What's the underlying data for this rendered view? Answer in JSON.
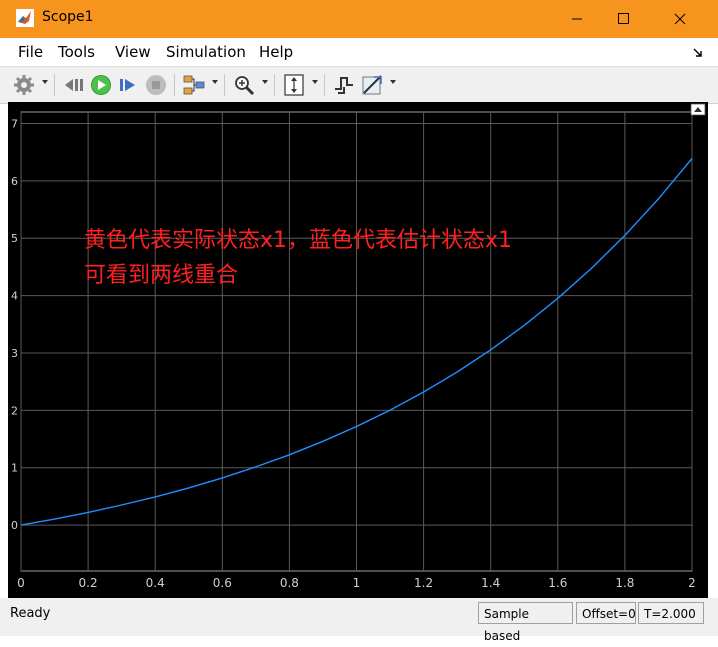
{
  "window": {
    "title": "Scope1"
  },
  "menu": {
    "items": [
      "File",
      "Tools",
      "View",
      "Simulation",
      "Help"
    ]
  },
  "toolbar": {
    "icons": [
      "gear-icon",
      "step-back-icon",
      "run-icon",
      "step-forward-icon",
      "stop-icon",
      "signal-selector-icon",
      "zoom-icon",
      "scale-axes-icon",
      "trigger-icon",
      "measurements-icon"
    ]
  },
  "annotation": {
    "line1": "黄色代表实际状态x1，蓝色代表估计状态x1",
    "line2": "可看到两线重合",
    "color": "#ff2020"
  },
  "chart_data": {
    "type": "line",
    "title": "",
    "xlabel": "",
    "ylabel": "",
    "xlim": [
      0,
      2
    ],
    "ylim": [
      -0.8,
      7.2
    ],
    "xticks": [
      "0",
      "0.2",
      "0.4",
      "0.6",
      "0.8",
      "1",
      "1.2",
      "1.4",
      "1.6",
      "1.8",
      "2"
    ],
    "yticks": [
      "0",
      "1",
      "2",
      "3",
      "4",
      "5",
      "6",
      "7"
    ],
    "grid": true,
    "background": "#000000",
    "series": [
      {
        "color": "#1e90ff",
        "x": [
          0,
          0.1,
          0.2,
          0.3,
          0.4,
          0.5,
          0.6,
          0.7,
          0.8,
          0.9,
          1.0,
          1.1,
          1.2,
          1.3,
          1.4,
          1.5,
          1.6,
          1.7,
          1.8,
          1.9,
          2.0
        ],
        "y": [
          0,
          0.105,
          0.221,
          0.35,
          0.492,
          0.649,
          0.822,
          1.014,
          1.226,
          1.46,
          1.718,
          2.004,
          2.32,
          2.669,
          3.055,
          3.482,
          3.953,
          4.474,
          5.05,
          5.686,
          6.389
        ]
      }
    ]
  },
  "status": {
    "ready": "Ready",
    "mode": "Sample based",
    "offset": "Offset=0",
    "time": "T=2.000"
  }
}
